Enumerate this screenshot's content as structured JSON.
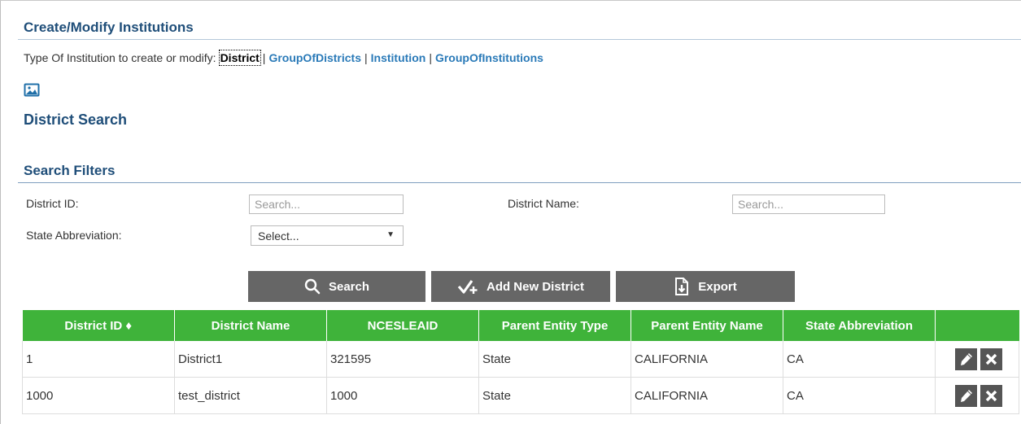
{
  "page": {
    "title": "Create/Modify Institutions",
    "type_prompt": "Type Of Institution to create or modify:",
    "types": [
      {
        "label": "District",
        "active": true
      },
      {
        "label": "GroupOfDistricts",
        "active": false
      },
      {
        "label": "Institution",
        "active": false
      },
      {
        "label": "GroupOfInstitutions",
        "active": false
      }
    ],
    "separator": "|",
    "section_title": "District Search"
  },
  "filters": {
    "title": "Search Filters",
    "district_id_label": "District ID:",
    "district_id_placeholder": "Search...",
    "district_name_label": "District Name:",
    "district_name_placeholder": "Search...",
    "state_label": "State Abbreviation:",
    "state_selected": "Select..."
  },
  "actions": {
    "search_label": "Search",
    "add_label": "Add New District",
    "export_label": "Export"
  },
  "table": {
    "columns": [
      "District ID ♦",
      "District Name",
      "NCESLEAID",
      "Parent Entity Type",
      "Parent Entity Name",
      "State Abbreviation",
      ""
    ],
    "rows": [
      [
        "1",
        "District1",
        "321595",
        "State",
        "CALIFORNIA",
        "CA"
      ],
      [
        "1000",
        "test_district",
        "1000",
        "State",
        "CALIFORNIA",
        "CA"
      ]
    ]
  },
  "colors": {
    "header_green": "#3fb33a",
    "button_gray": "#666666",
    "title_blue": "#1f4e79",
    "link_blue": "#2a7ab8"
  },
  "icons": {
    "broken_image": "image-icon",
    "search": "search-icon",
    "add": "add-check-icon",
    "export": "export-icon",
    "edit": "pencil-icon",
    "delete": "close-icon"
  }
}
